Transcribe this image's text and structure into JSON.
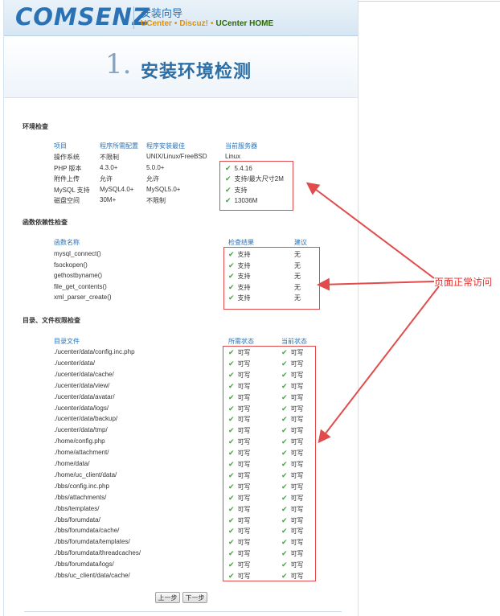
{
  "header": {
    "logo": "COMSENZ",
    "wizard_title": "安装向导",
    "products": [
      "UCenter",
      "Discuz!",
      "UCenter HOME"
    ],
    "dot": "•"
  },
  "step": {
    "number": "1.",
    "title": "安装环境检测"
  },
  "env_check": {
    "section_title": "环境检查",
    "headers": [
      "项目",
      "程序所需配置",
      "程序安装最佳",
      "当前服务器"
    ],
    "rows": [
      {
        "item": "操作系统",
        "required": "不限制",
        "best": "UNIX/Linux/FreeBSD",
        "current": "Linux",
        "ok": false
      },
      {
        "item": "PHP 版本",
        "required": "4.3.0+",
        "best": "5.0.0+",
        "current": "5.4.16",
        "ok": true
      },
      {
        "item": "附件上传",
        "required": "允许",
        "best": "允许",
        "current": "支持/最大尺寸2M",
        "ok": true
      },
      {
        "item": "MySQL 支持",
        "required": "MySQL4.0+",
        "best": "MySQL5.0+",
        "current": "支持",
        "ok": true
      },
      {
        "item": "磁盘空间",
        "required": "30M+",
        "best": "不限制",
        "current": "13036M",
        "ok": true
      }
    ]
  },
  "func_check": {
    "section_title": "函数依赖性检查",
    "headers": [
      "函数名称",
      "检查结果",
      "建议"
    ],
    "rows": [
      {
        "name": "mysql_connect()",
        "result": "支持",
        "advice": "无"
      },
      {
        "name": "fsockopen()",
        "result": "支持",
        "advice": "无"
      },
      {
        "name": "gethostbyname()",
        "result": "支持",
        "advice": "无"
      },
      {
        "name": "file_get_contents()",
        "result": "支持",
        "advice": "无"
      },
      {
        "name": "xml_parser_create()",
        "result": "支持",
        "advice": "无"
      }
    ]
  },
  "dir_check": {
    "section_title": "目录、文件权限检查",
    "headers": [
      "目录文件",
      "所需状态",
      "当前状态"
    ],
    "rows": [
      {
        "path": "./ucenter/data/config.inc.php",
        "required": "可写",
        "current": "可写"
      },
      {
        "path": "./ucenter/data/",
        "required": "可写",
        "current": "可写"
      },
      {
        "path": "./ucenter/data/cache/",
        "required": "可写",
        "current": "可写"
      },
      {
        "path": "./ucenter/data/view/",
        "required": "可写",
        "current": "可写"
      },
      {
        "path": "./ucenter/data/avatar/",
        "required": "可写",
        "current": "可写"
      },
      {
        "path": "./ucenter/data/logs/",
        "required": "可写",
        "current": "可写"
      },
      {
        "path": "./ucenter/data/backup/",
        "required": "可写",
        "current": "可写"
      },
      {
        "path": "./ucenter/data/tmp/",
        "required": "可写",
        "current": "可写"
      },
      {
        "path": "./home/config.php",
        "required": "可写",
        "current": "可写"
      },
      {
        "path": "./home/attachment/",
        "required": "可写",
        "current": "可写"
      },
      {
        "path": "./home/data/",
        "required": "可写",
        "current": "可写"
      },
      {
        "path": "./home/uc_client/data/",
        "required": "可写",
        "current": "可写"
      },
      {
        "path": "./bbs/config.inc.php",
        "required": "可写",
        "current": "可写"
      },
      {
        "path": "./bbs/attachments/",
        "required": "可写",
        "current": "可写"
      },
      {
        "path": "./bbs/templates/",
        "required": "可写",
        "current": "可写"
      },
      {
        "path": "./bbs/forumdata/",
        "required": "可写",
        "current": "可写"
      },
      {
        "path": "./bbs/forumdata/cache/",
        "required": "可写",
        "current": "可写"
      },
      {
        "path": "./bbs/forumdata/templates/",
        "required": "可写",
        "current": "可写"
      },
      {
        "path": "./bbs/forumdata/threadcaches/",
        "required": "可写",
        "current": "可写"
      },
      {
        "path": "./bbs/forumdata/logs/",
        "required": "可写",
        "current": "可写"
      },
      {
        "path": "./bbs/uc_client/data/cache/",
        "required": "可写",
        "current": "可写"
      }
    ]
  },
  "buttons": {
    "prev": "上一步",
    "next": "下一步"
  },
  "annotation": {
    "text": "页面正常访问",
    "color": "#e0302e"
  },
  "colors": {
    "accent": "#2b72b5",
    "check": "#3fa63a",
    "highlight": "#e24b4b"
  }
}
